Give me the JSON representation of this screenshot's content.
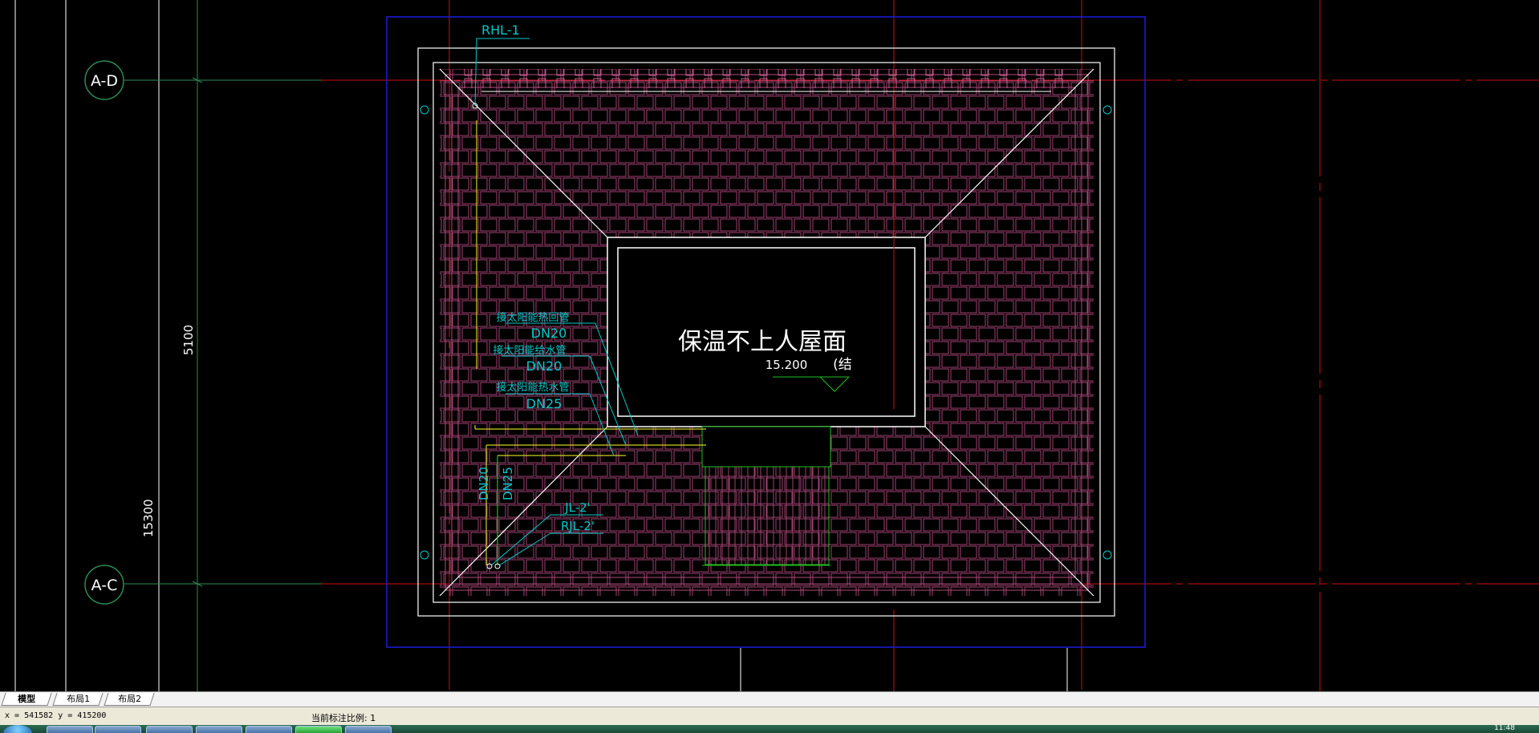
{
  "drawing": {
    "axis_top_label": "A-D",
    "axis_bottom_label": "A-C",
    "dim_upper": "5100",
    "dim_lower": "15300",
    "rhl_label": "RHL-1",
    "roof_title": "保温不上人屋面",
    "elevation": "15.200",
    "elevation_note": "(结",
    "pipe_labels": [
      {
        "name": "接太阳能热回管",
        "size": "DN20"
      },
      {
        "name": "接太阳能给水管",
        "size": "DN20"
      },
      {
        "name": "接太阳能热水管",
        "size": "DN25"
      }
    ],
    "vertical_size_1": "DN20",
    "vertical_size_2": "DN25",
    "jl_label": "JL-2'",
    "rjl_label": "RJL-2'"
  },
  "tabs": [
    {
      "label": "模型",
      "active": true
    },
    {
      "label": "布局1",
      "active": false
    },
    {
      "label": "布局2",
      "active": false
    }
  ],
  "status": {
    "coords": "x = 541582  y = 415200",
    "scale_text": "当前标注比例: 1"
  },
  "taskbar": {
    "clock": "11:48"
  },
  "colors": {
    "background": "#000000",
    "cyan": "#00c8c8",
    "green_axis": "#2e8b57",
    "red_axis": "#d01010",
    "blue_frame": "#1c1cdc",
    "magenta_tiles": "#b04a78",
    "yellow_pipe": "#cfcf20",
    "green_pipe": "#20c020"
  }
}
